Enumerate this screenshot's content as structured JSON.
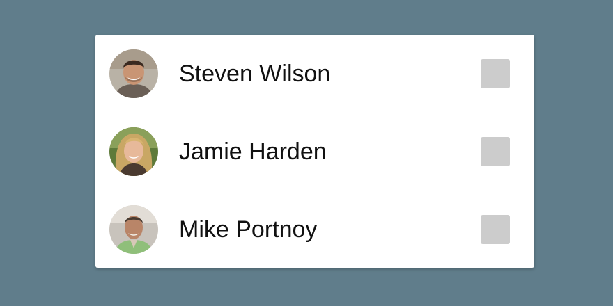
{
  "contacts": [
    {
      "name": "Steven Wilson",
      "avatar_icon": "person-avatar-icon",
      "checked": false
    },
    {
      "name": "Jamie Harden",
      "avatar_icon": "person-avatar-icon",
      "checked": false
    },
    {
      "name": "Mike Portnoy",
      "avatar_icon": "person-avatar-icon",
      "checked": false
    }
  ],
  "colors": {
    "background": "#607d8b",
    "card": "#ffffff",
    "checkbox_unchecked": "#cccccc",
    "text": "#111111"
  }
}
